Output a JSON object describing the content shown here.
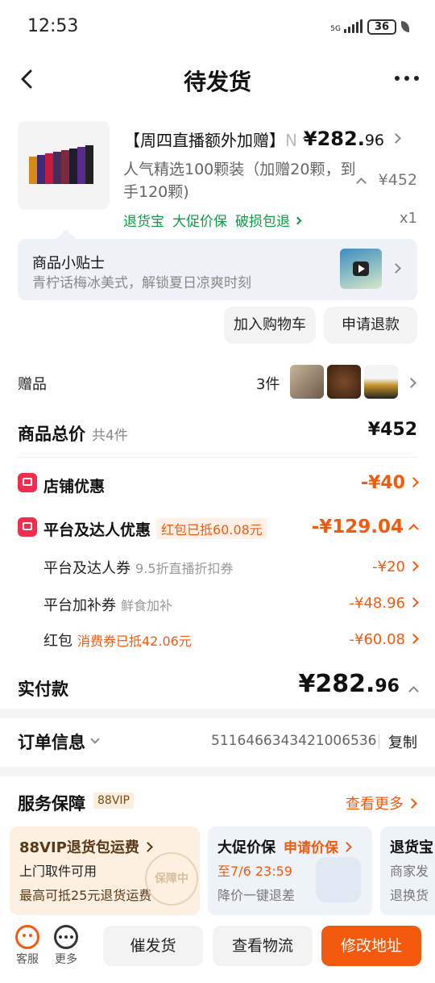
{
  "status_bar": {
    "time": "12:53",
    "network": "5G",
    "battery": "36"
  },
  "header": {
    "title": "待发货"
  },
  "product": {
    "name_visible": "【周四直播额外加赠】",
    "name_truncated": "N",
    "description": "人气精选100颗装（加赠20颗，到手120颗)",
    "price_int": "¥282.",
    "price_dec": "96",
    "original_price": "¥452",
    "quantity": "x1",
    "tags": [
      "退货宝",
      "大促价保",
      "破损包退"
    ]
  },
  "tips": {
    "title": "商品小贴士",
    "text": "青柠话梅冰美式，解锁夏日凉爽时刻"
  },
  "actions": {
    "add_cart": "加入购物车",
    "refund": "申请退款"
  },
  "gift": {
    "label": "赠品",
    "count": "3件"
  },
  "summary": {
    "total_label": "商品总价",
    "total_sub": "共4件",
    "total_value": "¥452"
  },
  "discounts": {
    "shop": {
      "label": "店铺优惠",
      "value": "-¥40"
    },
    "platform": {
      "label": "平台及达人优惠",
      "pill": "红包已抵60.08元",
      "value": "-¥129.04"
    },
    "items": [
      {
        "label": "平台及达人券",
        "note": "9.5折直播折扣券",
        "value": "-¥20"
      },
      {
        "label": "平台加补券",
        "note": "鲜食加补",
        "value": "-¥48.96"
      },
      {
        "label": "红包",
        "note": "消费券已抵42.06元",
        "value": "-¥60.08"
      }
    ]
  },
  "paid": {
    "label": "实付款",
    "int": "¥282.",
    "dec": "96"
  },
  "order": {
    "label": "订单信息",
    "number": "5116466343421006536",
    "copy": "复制"
  },
  "service": {
    "label": "服务保障",
    "vip": "88VIP",
    "see_more": "查看更多",
    "cards": [
      {
        "title": "88VIP退货包运费",
        "line1": "上门取件可用",
        "line2": "最高可抵25元退货运费",
        "stamp": "保障中"
      },
      {
        "title": "大促价保",
        "action": "申请价保",
        "line1": "至7/6 23:59",
        "line2": "降价一键退差"
      },
      {
        "title": "退货宝",
        "line1": "商家发",
        "line2": "退换货"
      }
    ]
  },
  "bottom": {
    "service": "客服",
    "more": "更多",
    "remind": "催发货",
    "logistics": "查看物流",
    "modify": "修改地址"
  },
  "colors": {
    "accent": "#f45a0d",
    "green": "#0a9b45",
    "red": "#f02d4c"
  }
}
